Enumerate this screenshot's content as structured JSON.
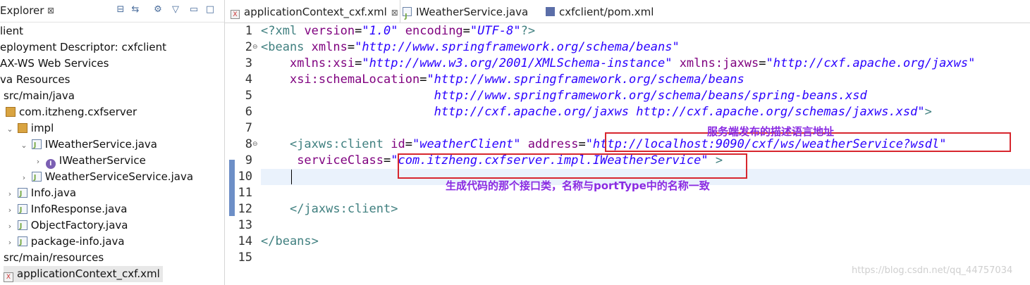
{
  "explorer": {
    "title": "Explorer",
    "close": "⊠",
    "toolbar_icons": [
      "collapse-all-icon",
      "link-with-editor-icon",
      "filter-icon",
      "view-menu-icon",
      "minimize-icon",
      "maximize-icon"
    ],
    "items": [
      {
        "label": "lient"
      },
      {
        "label": "eployment Descriptor: cxfclient"
      },
      {
        "label": "AX-WS Web Services"
      },
      {
        "label": "va Resources"
      },
      {
        "label": "src/main/java"
      },
      {
        "label": "com.itzheng.cxfserver"
      },
      {
        "label": "impl"
      },
      {
        "label": "IWeatherService.java"
      },
      {
        "label": "IWeatherService"
      },
      {
        "label": "WeatherServiceService.java"
      },
      {
        "label": "Info.java"
      },
      {
        "label": "InfoResponse.java"
      },
      {
        "label": "ObjectFactory.java"
      },
      {
        "label": "package-info.java"
      },
      {
        "label": "src/main/resources"
      },
      {
        "label": "applicationContext_cxf.xml"
      }
    ]
  },
  "tabs": [
    {
      "label": "applicationContext_cxf.xml",
      "close": "⊠"
    },
    {
      "label": "IWeatherService.java"
    },
    {
      "label": "cxfclient/pom.xml"
    }
  ],
  "editor": {
    "line_numbers": [
      "1",
      "2",
      "3",
      "4",
      "5",
      "6",
      "7",
      "8",
      "9",
      "10",
      "11",
      "12",
      "13",
      "14",
      "15"
    ],
    "lines": [
      "<?xml version=\"1.0\" encoding=\"UTF-8\"?>",
      "<beans xmlns=\"http://www.springframework.org/schema/beans\"",
      "    xmlns:xsi=\"http://www.w3.org/2001/XMLSchema-instance\" xmlns:jaxws=\"http://cxf.apache.org/jaxws\"",
      "    xsi:schemaLocation=\"http://www.springframework.org/schema/beans",
      "                        http://www.springframework.org/schema/beans/spring-beans.xsd",
      "                        http://cxf.apache.org/jaxws http://cxf.apache.org/schemas/jaxws.xsd\">",
      "",
      "    <jaxws:client id=\"weatherClient\" address=\"http://localhost:9090/cxf/ws/weatherService?wsdl\"",
      "     serviceClass=\"com.itzheng.cxfserver.impl.IWeatherService\" >",
      "",
      "",
      "    </jaxws:client>",
      "",
      "</beans>",
      ""
    ]
  },
  "annotations": {
    "note1": "服务端发布的描述语言地址",
    "note2": "生成代码的那个接口类，名称与portType中的名称一致"
  },
  "watermark": "https://blog.csdn.net/qq_44757034",
  "colors": {
    "tag": "#3f7f7f",
    "attr_name": "#7f007f",
    "attr_value": "#2a00ff",
    "annotation_box": "#d7262e",
    "annotation_text": "#8a2be2"
  }
}
